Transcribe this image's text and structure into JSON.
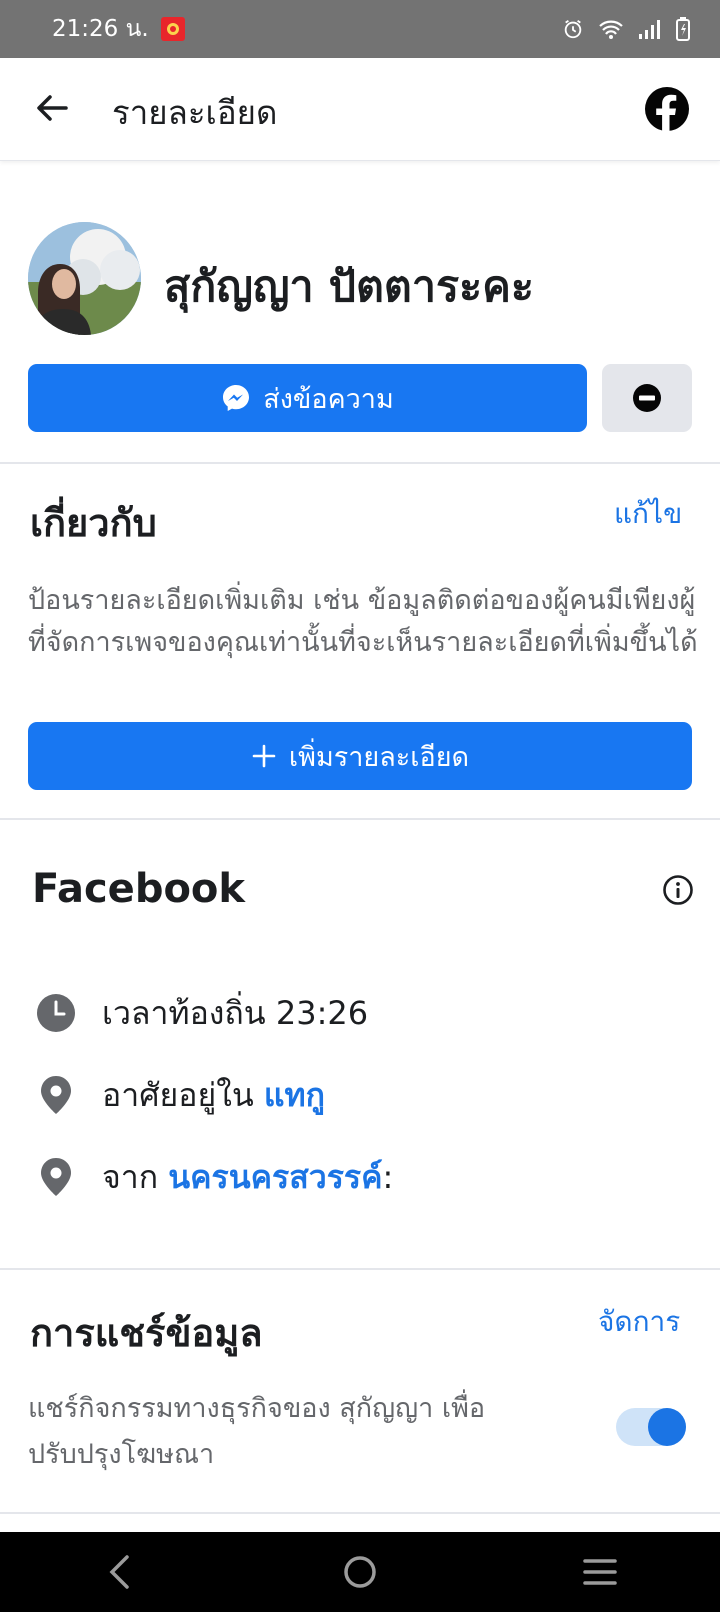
{
  "status_bar": {
    "time": "21:26 น.",
    "icons": [
      "alarm-icon",
      "wifi-icon",
      "signal-icon",
      "battery-icon"
    ]
  },
  "header": {
    "title": "รายละเอียด",
    "back_icon": "arrow-left-icon",
    "logo_icon": "facebook-logo-icon"
  },
  "profile": {
    "name": "สุกัญญา ปัตตาระคะ",
    "message_button": "ส่งข้อความ",
    "block_icon": "no-entry-icon"
  },
  "about": {
    "title": "เกี่ยวกับ",
    "edit": "แก้ไข",
    "description": "ป้อนรายละเอียดเพิ่มเติม เช่น ข้อมูลติดต่อของผู้คนมีเพียงผู้ที่จัดการเพจของคุณเท่านั้นที่จะเห็นรายละเอียดที่เพิ่มขึ้นได้",
    "add_button": "เพิ่มรายละเอียด"
  },
  "facebook_info": {
    "title": "Facebook",
    "local_time_label": "เวลาท้องถิ่น 23:26",
    "lives_in_prefix": "อาศัยอยู่ใน",
    "lives_in_place": "แทกู",
    "from_prefix": "จาก",
    "from_place": "นครนครสวรรค์",
    "from_suffix": ":"
  },
  "data_sharing": {
    "title": "การแชร์ข้อมูล",
    "manage": "จัดการ",
    "description": "แชร์กิจกรรมทางธุรกิจของ สุกัญญา เพื่อปรับปรุงโฆษณา",
    "toggle_on": true
  },
  "colors": {
    "primary": "#1877f2",
    "link": "#1b74e4",
    "secondary_text": "#65676b",
    "status_bar": "#737373"
  }
}
